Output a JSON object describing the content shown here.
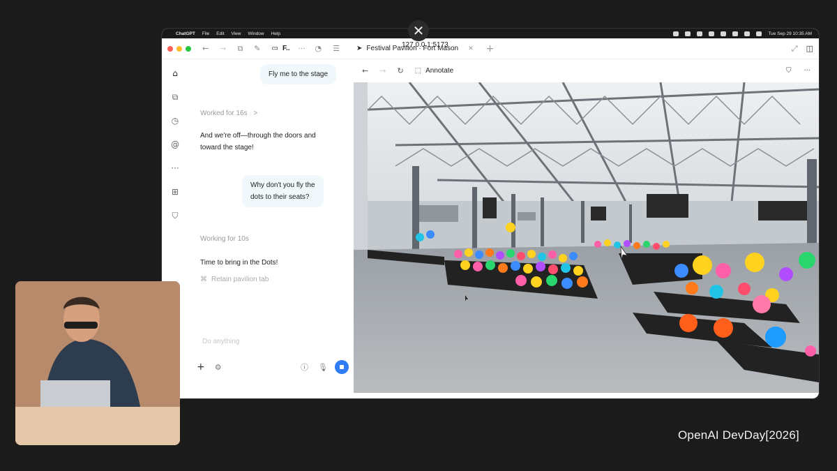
{
  "overlay": {
    "close_icon": "close-icon"
  },
  "menubar": {
    "app_name": "ChatGPT",
    "menus": [
      "File",
      "Edit",
      "View",
      "Window",
      "Help"
    ],
    "clock": "Tue Sep 29  10:35 AM"
  },
  "tabstrip": {
    "folder_label": "F..",
    "more": "···",
    "active_tab_title": "Festival Pavilion · Fort Mason",
    "new_tab": "+"
  },
  "chat": {
    "messages": [
      {
        "role": "user",
        "text": "Fly me to the stage"
      },
      {
        "role": "status",
        "text": "Worked for 16s",
        "chevron": ">"
      },
      {
        "role": "assistant",
        "text_line1": "And we're off—through the doors and",
        "text_line2": "toward the stage!"
      },
      {
        "role": "user",
        "text_line1": "Why don't you fly the",
        "text_line2": "dots to their seats?"
      },
      {
        "role": "status",
        "text": "Working for 10s"
      },
      {
        "role": "assistant",
        "text": "Time to bring in the Dots!"
      },
      {
        "role": "task",
        "text": "Retain pavilion tab"
      }
    ],
    "composer_placeholder": "Do anything"
  },
  "browser": {
    "annotate_label": "Annotate",
    "url": "127.0.0.1:5173"
  },
  "branding": {
    "text": "OpenAI DevDay[2026]"
  },
  "colors": {
    "accent": "#2f7cf6",
    "user_bubble": "#f0f8fb",
    "background": "#1b1b1b"
  }
}
